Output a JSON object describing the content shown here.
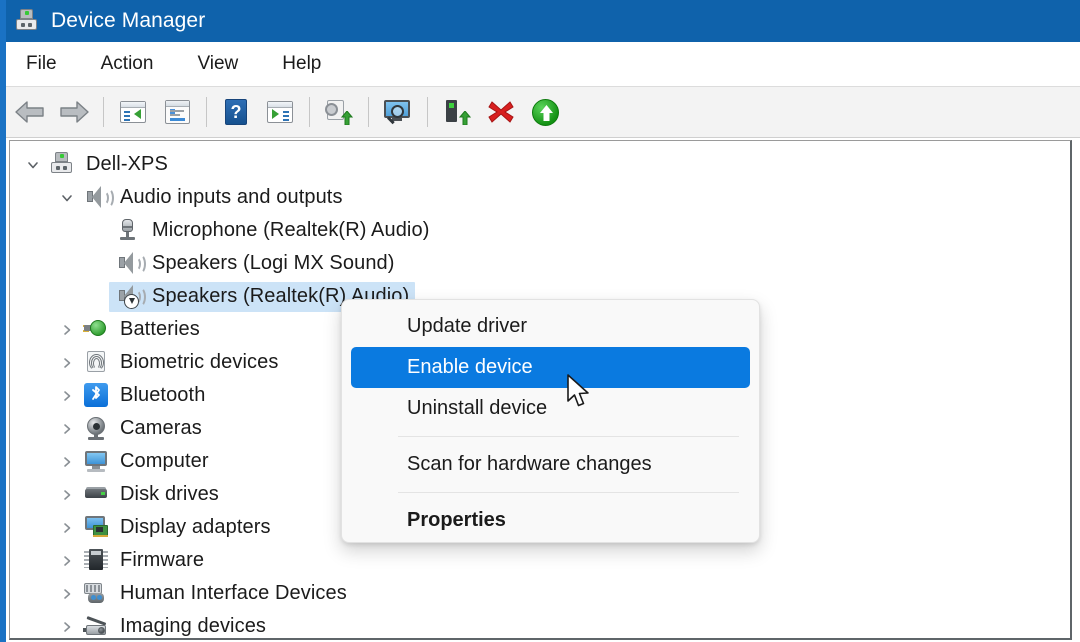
{
  "window": {
    "title": "Device Manager",
    "title_icon": "device-manager-icon"
  },
  "menubar": {
    "items": [
      {
        "label": "File",
        "name": "menu-file"
      },
      {
        "label": "Action",
        "name": "menu-action"
      },
      {
        "label": "View",
        "name": "menu-view"
      },
      {
        "label": "Help",
        "name": "menu-help"
      }
    ]
  },
  "toolbar": {
    "buttons": [
      {
        "name": "back-button",
        "icon": "back-arrow-icon",
        "tooltip": "Back"
      },
      {
        "name": "forward-button",
        "icon": "forward-arrow-icon",
        "tooltip": "Forward"
      },
      {
        "name": "show-hide-console-tree-button",
        "icon": "console-tree-icon",
        "tooltip": "Show/Hide Console Tree"
      },
      {
        "name": "properties-button",
        "icon": "properties-icon",
        "tooltip": "Properties"
      },
      {
        "name": "help-button",
        "icon": "help-icon",
        "tooltip": "Help"
      },
      {
        "name": "show-hide-action-pane-button",
        "icon": "action-pane-icon",
        "tooltip": "Show/Hide Action Pane"
      },
      {
        "name": "update-driver-button",
        "icon": "update-driver-icon",
        "tooltip": "Update driver"
      },
      {
        "name": "scan-for-hardware-changes-button",
        "icon": "scan-hardware-icon",
        "tooltip": "Scan for hardware changes"
      },
      {
        "name": "enable-device-button",
        "icon": "enable-device-icon",
        "tooltip": "Enable device"
      },
      {
        "name": "disable-device-button",
        "icon": "red-x-icon",
        "tooltip": "Disable device"
      },
      {
        "name": "update-device-button",
        "icon": "green-up-arrow-icon",
        "tooltip": "Update device"
      }
    ]
  },
  "tree": {
    "rows": [
      {
        "label": "Dell-XPS",
        "icon": "computer-device-icon",
        "level": 0,
        "expander": "chevron-down",
        "selected": false
      },
      {
        "label": "Audio inputs and outputs",
        "icon": "speaker-icon",
        "level": 1,
        "expander": "chevron-down",
        "selected": false
      },
      {
        "label": "Microphone (Realtek(R) Audio)",
        "icon": "microphone-icon",
        "level": 2,
        "expander": "none",
        "selected": false
      },
      {
        "label": "Speakers (Logi MX Sound)",
        "icon": "speaker-icon",
        "level": 2,
        "expander": "none",
        "selected": false
      },
      {
        "label": "Speakers (Realtek(R) Audio)",
        "icon": "speaker-disabled-icon",
        "level": 2,
        "expander": "none",
        "selected": true
      },
      {
        "label": "Batteries",
        "icon": "battery-icon",
        "level": 1,
        "expander": "chevron-right",
        "selected": false
      },
      {
        "label": "Biometric devices",
        "icon": "fingerprint-icon",
        "level": 1,
        "expander": "chevron-right",
        "selected": false
      },
      {
        "label": "Bluetooth",
        "icon": "bluetooth-icon",
        "level": 1,
        "expander": "chevron-right",
        "selected": false
      },
      {
        "label": "Cameras",
        "icon": "camera-icon",
        "level": 1,
        "expander": "chevron-right",
        "selected": false
      },
      {
        "label": "Computer",
        "icon": "monitor-icon",
        "level": 1,
        "expander": "chevron-right",
        "selected": false
      },
      {
        "label": "Disk drives",
        "icon": "disk-drive-icon",
        "level": 1,
        "expander": "chevron-right",
        "selected": false
      },
      {
        "label": "Display adapters",
        "icon": "display-adapter-icon",
        "level": 1,
        "expander": "chevron-right",
        "selected": false
      },
      {
        "label": "Firmware",
        "icon": "firmware-chip-icon",
        "level": 1,
        "expander": "chevron-right",
        "selected": false
      },
      {
        "label": "Human Interface Devices",
        "icon": "hid-icon",
        "level": 1,
        "expander": "chevron-right",
        "selected": false
      },
      {
        "label": "Imaging devices",
        "icon": "imaging-device-icon",
        "level": 1,
        "expander": "chevron-right",
        "selected": false
      }
    ]
  },
  "context_menu": {
    "items": [
      {
        "label": "Update driver",
        "name": "ctx-update-driver",
        "highlight": false,
        "bold": false
      },
      {
        "label": "Enable device",
        "name": "ctx-enable-device",
        "highlight": true,
        "bold": false
      },
      {
        "label": "Uninstall device",
        "name": "ctx-uninstall-device",
        "highlight": false,
        "bold": false
      },
      {
        "label": "Scan for hardware changes",
        "name": "ctx-scan-for-hardware-changes",
        "highlight": false,
        "bold": false
      },
      {
        "label": "Properties",
        "name": "ctx-properties",
        "highlight": false,
        "bold": true
      }
    ]
  },
  "colors": {
    "titlebar": "#0f62ab",
    "menu_highlight": "#0a7ae0",
    "tree_selection": "#cce3f7",
    "toolbar_bg": "#f3f3f3",
    "context_menu_bg": "#f9f9f9"
  }
}
